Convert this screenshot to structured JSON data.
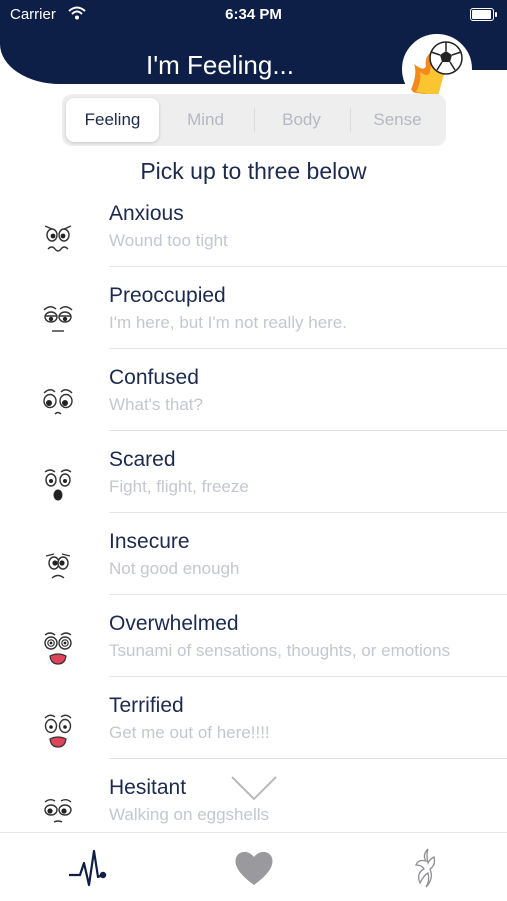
{
  "status_bar": {
    "carrier": "Carrier",
    "time": "6:34 PM"
  },
  "header": {
    "title": "I'm Feeling...",
    "avatar_icon": "soccer-ball-fire-icon"
  },
  "tabs": [
    {
      "label": "Feeling",
      "active": true
    },
    {
      "label": "Mind",
      "active": false
    },
    {
      "label": "Body",
      "active": false
    },
    {
      "label": "Sense",
      "active": false
    }
  ],
  "instruction": "Pick up to three below",
  "feelings": [
    {
      "label": "Anxious",
      "description": "Wound too tight",
      "icon": "anxious-face-icon"
    },
    {
      "label": "Preoccupied",
      "description": "I'm here, but I'm not really here.",
      "icon": "preoccupied-face-icon"
    },
    {
      "label": "Confused",
      "description": "What's that?",
      "icon": "confused-face-icon"
    },
    {
      "label": "Scared",
      "description": "Fight, flight, freeze",
      "icon": "scared-face-icon"
    },
    {
      "label": "Insecure",
      "description": "Not good enough",
      "icon": "insecure-face-icon"
    },
    {
      "label": "Overwhelmed",
      "description": "Tsunami of sensations, thoughts, or emotions",
      "icon": "overwhelmed-face-icon"
    },
    {
      "label": "Terrified",
      "description": "Get me out of here!!!!",
      "icon": "terrified-face-icon"
    },
    {
      "label": "Hesitant",
      "description": "Walking on eggshells",
      "icon": "hesitant-face-icon"
    }
  ],
  "bottom_tabs": [
    {
      "icon": "heartbeat-pulse-icon",
      "active": true
    },
    {
      "icon": "heart-icon",
      "active": false
    },
    {
      "icon": "phoenix-icon",
      "active": false
    }
  ],
  "colors": {
    "navy": "#0d1f47",
    "text": "#1d2a4e",
    "muted": "#c4c7cf",
    "accent_red": "#e0445a"
  }
}
